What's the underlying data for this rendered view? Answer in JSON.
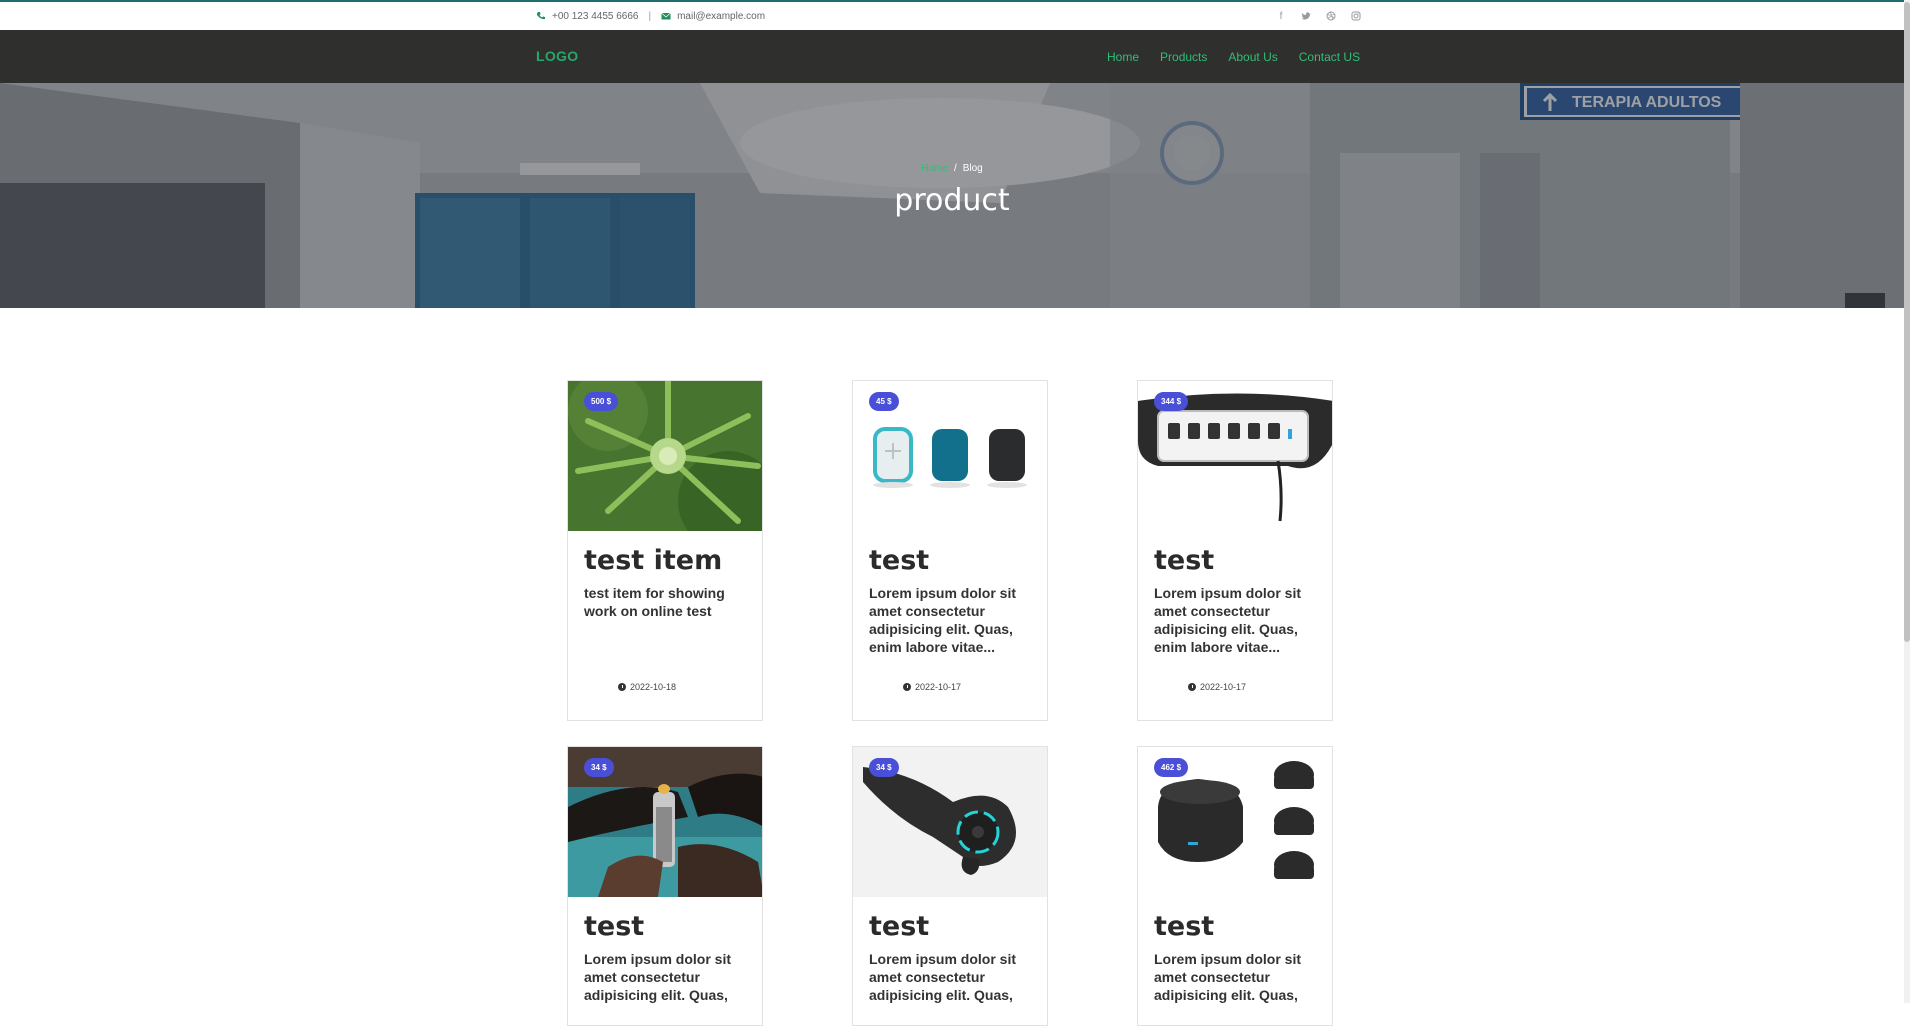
{
  "topbar": {
    "phone": "+00 123 4455 6666",
    "email": "mail@example.com",
    "social": [
      "facebook-icon",
      "twitter-icon",
      "dribbble-icon",
      "instagram-icon"
    ]
  },
  "navbar": {
    "logo": "LOGO",
    "links": [
      "Home",
      "Products",
      "About Us",
      "Contact US"
    ]
  },
  "hero": {
    "breadcrumb_home": "Home",
    "breadcrumb_sep": "/",
    "breadcrumb_current": "Blog",
    "title": "product",
    "sign_text": "TERAPIA ADULTOS"
  },
  "products": [
    {
      "price": "500 $",
      "title": "test item",
      "desc": "test item for showing work on online test",
      "date": "2022-10-18",
      "image": "cannabis-plant"
    },
    {
      "price": "45 $",
      "title": "test",
      "desc": "Lorem ipsum dolor sit amet consectetur adipisicing elit. Quas, enim labore vitae... recusandae distinctio",
      "date": "2022-10-17",
      "image": "three-devices"
    },
    {
      "price": "344 $",
      "title": "test",
      "desc": "Lorem ipsum dolor sit amet consectetur adipisicing elit. Quas, enim labore vitae... recusandae distinctio",
      "date": "2022-10-17",
      "image": "power-strip"
    },
    {
      "price": "34 $",
      "title": "test",
      "desc": "Lorem ipsum dolor sit amet consectetur adipisicing elit. Quas,",
      "date": "",
      "image": "person-lighter"
    },
    {
      "price": "34 $",
      "title": "test",
      "desc": "Lorem ipsum dolor sit amet consectetur adipisicing elit. Quas,",
      "date": "",
      "image": "handheld-device"
    },
    {
      "price": "462 $",
      "title": "test",
      "desc": "Lorem ipsum dolor sit amet consectetur adipisicing elit. Quas,",
      "date": "",
      "image": "black-pucks"
    }
  ],
  "colors": {
    "accent": "#2fbf75",
    "badge": "#4a4fd8",
    "navbar": "#2f2f2d"
  }
}
